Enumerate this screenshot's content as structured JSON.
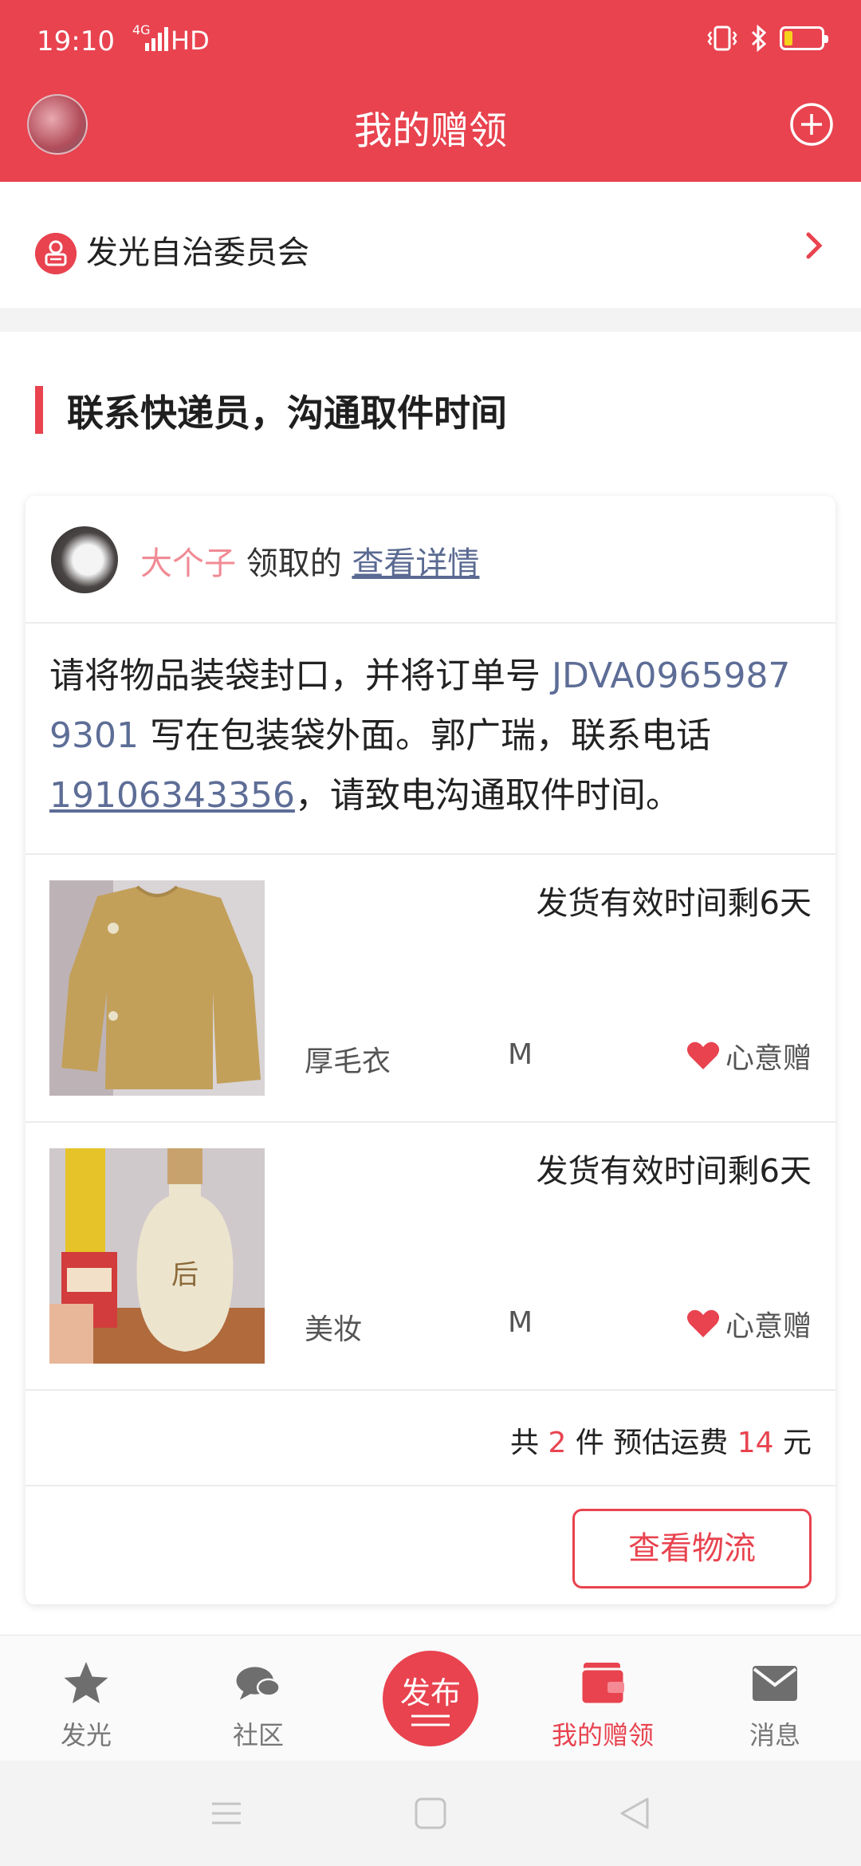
{
  "status_bar": {
    "time": "19:10",
    "network": "4G",
    "hd": "HD"
  },
  "header": {
    "title": "我的赠领"
  },
  "organization": {
    "name": "发光自治委员会"
  },
  "section": {
    "title": "联系快递员，沟通取件时间"
  },
  "card": {
    "giver": {
      "name": "大个子",
      "suffix": "领取的",
      "link": "查看详情"
    },
    "instruction": {
      "part1": "请将物品装袋封口，并将订单号 ",
      "order_no": "JDVA09659879301",
      "part2": " 写在包装袋外面。郭广瑞，联系电话",
      "phone": "19106343356",
      "part3": "，请致电沟通取件时间。"
    },
    "items": [
      {
        "deadline": "发货有效时间剩6天",
        "name": "厚毛衣",
        "size": "M",
        "type": "心意赠"
      },
      {
        "deadline": "发货有效时间剩6天",
        "name": "美妆",
        "size": "M",
        "type": "心意赠"
      }
    ],
    "summary": {
      "prefix": "共 ",
      "count": "2",
      "middle": " 件 预估运费 ",
      "fee": "14",
      "suffix": " 元"
    },
    "logistics_button": "查看物流"
  },
  "tabbar": {
    "tabs": [
      {
        "label": "发光",
        "icon": "star-icon"
      },
      {
        "label": "社区",
        "icon": "chat-bubbles-icon"
      },
      {
        "label": "我的赠领",
        "icon": "wallet-icon",
        "active": true
      },
      {
        "label": "消息",
        "icon": "envelope-icon"
      }
    ],
    "publish_label": "发布"
  },
  "colors": {
    "accent": "#e8434f",
    "link": "#5d6d96",
    "giver_name": "#f08b95"
  }
}
